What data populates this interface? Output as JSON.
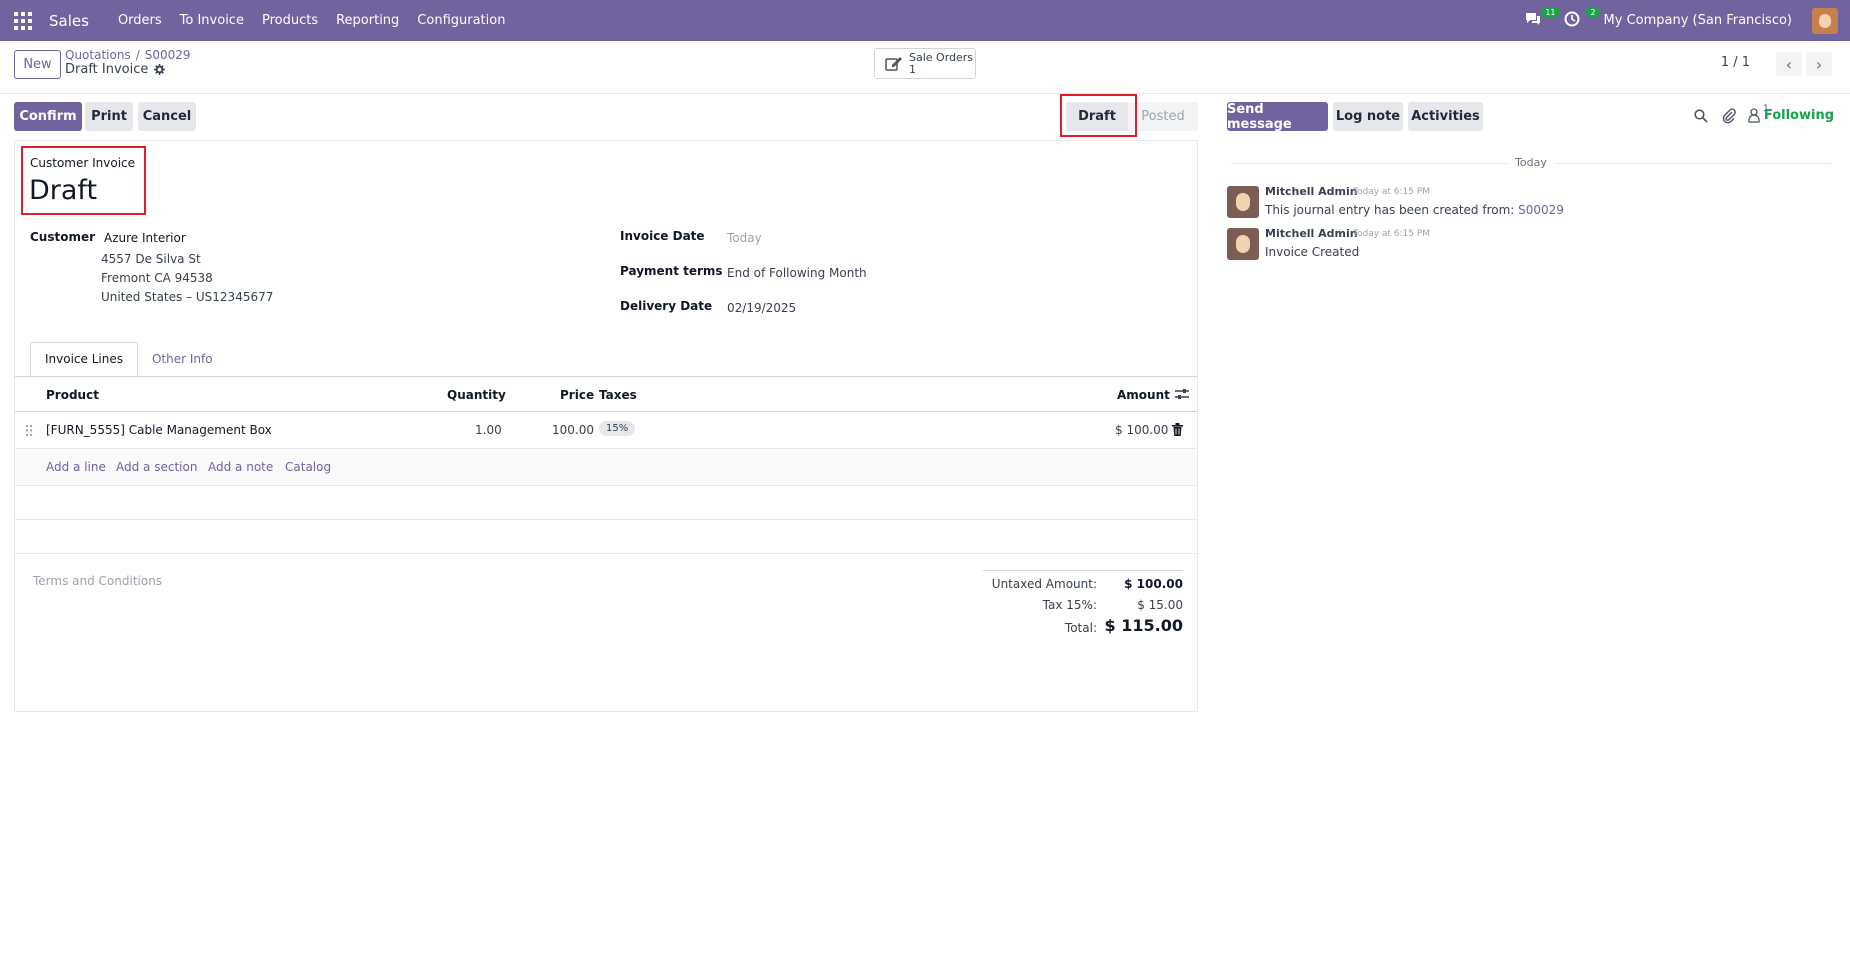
{
  "topnav": {
    "app_name": "Sales",
    "menu": [
      "Orders",
      "To Invoice",
      "Products",
      "Reporting",
      "Configuration"
    ],
    "messages_count": "11",
    "activities_count": "2",
    "company": "My Company (San Francisco)"
  },
  "control": {
    "new_label": "New",
    "breadcrumb_parent": "Quotations",
    "breadcrumb_current": "S00029",
    "record_title": "Draft Invoice",
    "smart_button_label": "Sale Orders",
    "smart_button_count": "1",
    "pager": "1 / 1"
  },
  "actions": {
    "confirm": "Confirm",
    "print": "Print",
    "cancel": "Cancel"
  },
  "status": {
    "stages": [
      "Draft",
      "Posted"
    ],
    "current": "Draft"
  },
  "invoice": {
    "type": "Customer Invoice",
    "name": "Draft",
    "customer_label": "Customer",
    "customer_name": "Azure Interior",
    "address_line1": "4557 De Silva St",
    "address_line2": "Fremont CA 94538",
    "address_line3": "United States – US12345677",
    "invoice_date_label": "Invoice Date",
    "invoice_date_placeholder": "Today",
    "payment_terms_label": "Payment terms",
    "payment_terms": "End of Following Month",
    "delivery_date_label": "Delivery Date",
    "delivery_date": "02/19/2025"
  },
  "tabs": [
    "Invoice Lines",
    "Other Info"
  ],
  "lines": {
    "headers": {
      "product": "Product",
      "quantity": "Quantity",
      "price": "Price",
      "taxes": "Taxes",
      "amount": "Amount"
    },
    "rows": [
      {
        "product": "[FURN_5555] Cable Management Box",
        "quantity": "1.00",
        "price": "100.00",
        "tax": "15%",
        "amount": "$ 100.00"
      }
    ],
    "add_links": [
      "Add a line",
      "Add a section",
      "Add a note",
      "Catalog"
    ]
  },
  "terms_placeholder": "Terms and Conditions",
  "totals": {
    "untaxed_label": "Untaxed Amount:",
    "untaxed": "$ 100.00",
    "tax_label": "Tax 15%:",
    "tax": "$ 15.00",
    "total_label": "Total:",
    "total": "$ 115.00"
  },
  "chatter": {
    "send_message": "Send message",
    "log_note": "Log note",
    "activities": "Activities",
    "followers_count": "1",
    "following": "Following",
    "date_separator": "Today",
    "messages": [
      {
        "author": "Mitchell Admin",
        "time": "Today at 6:15 PM",
        "body": "This journal entry has been created from: ",
        "link": "S00029"
      },
      {
        "author": "Mitchell Admin",
        "time": "Today at 6:15 PM",
        "body": "Invoice Created",
        "link": ""
      }
    ]
  },
  "colors": {
    "brand": "#71639e",
    "following": "#16a34a",
    "highlight": "#e11d2a"
  }
}
